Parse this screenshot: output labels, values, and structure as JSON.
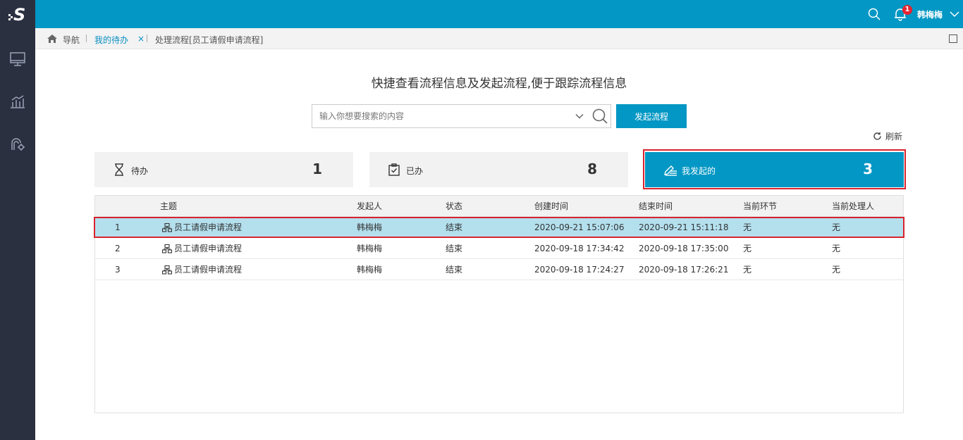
{
  "sidebar": {
    "logo": "S",
    "items": [
      {
        "icon": "monitor-icon"
      },
      {
        "icon": "chart-icon"
      },
      {
        "icon": "process-settings-icon"
      }
    ]
  },
  "topbar": {
    "notification_count": "1",
    "user_name": "韩梅梅"
  },
  "breadcrumb": {
    "home_label": "导航",
    "active_tab": "我的待办",
    "close_symbol": "×",
    "current": "处理流程[员工请假申请流程]"
  },
  "main": {
    "headline": "快捷查看流程信息及发起流程,便于跟踪流程信息",
    "search_placeholder": "输入你想要搜索的内容",
    "start_button": "发起流程",
    "refresh_label": "刷新"
  },
  "cards": [
    {
      "label": "待办",
      "count": "1",
      "icon": "hourglass-icon"
    },
    {
      "label": "已办",
      "count": "8",
      "icon": "clipboard-check-icon"
    },
    {
      "label": "我发起的",
      "count": "3",
      "icon": "edit-list-icon",
      "active": true
    }
  ],
  "table": {
    "headers": {
      "subject": "主题",
      "initiator": "发起人",
      "status": "状态",
      "created": "创建时间",
      "ended": "结束时间",
      "current_step": "当前环节",
      "current_handler": "当前处理人"
    },
    "rows": [
      {
        "index": "1",
        "subject": "员工请假申请流程",
        "initiator": "韩梅梅",
        "status": "结束",
        "created": "2020-09-21 15:07:06",
        "ended": "2020-09-21 15:11:18",
        "current_step": "无",
        "current_handler": "无"
      },
      {
        "index": "2",
        "subject": "员工请假申请流程",
        "initiator": "韩梅梅",
        "status": "结束",
        "created": "2020-09-18 17:34:42",
        "ended": "2020-09-18 17:35:00",
        "current_step": "无",
        "current_handler": "无"
      },
      {
        "index": "3",
        "subject": "员工请假申请流程",
        "initiator": "韩梅梅",
        "status": "结束",
        "created": "2020-09-18 17:24:27",
        "ended": "2020-09-18 17:26:21",
        "current_step": "无",
        "current_handler": "无"
      }
    ]
  },
  "colors": {
    "accent": "#0297c4",
    "sidebar": "#2a3040",
    "selected_row": "#b4e0ee",
    "highlight_outline": "#d9232d"
  }
}
